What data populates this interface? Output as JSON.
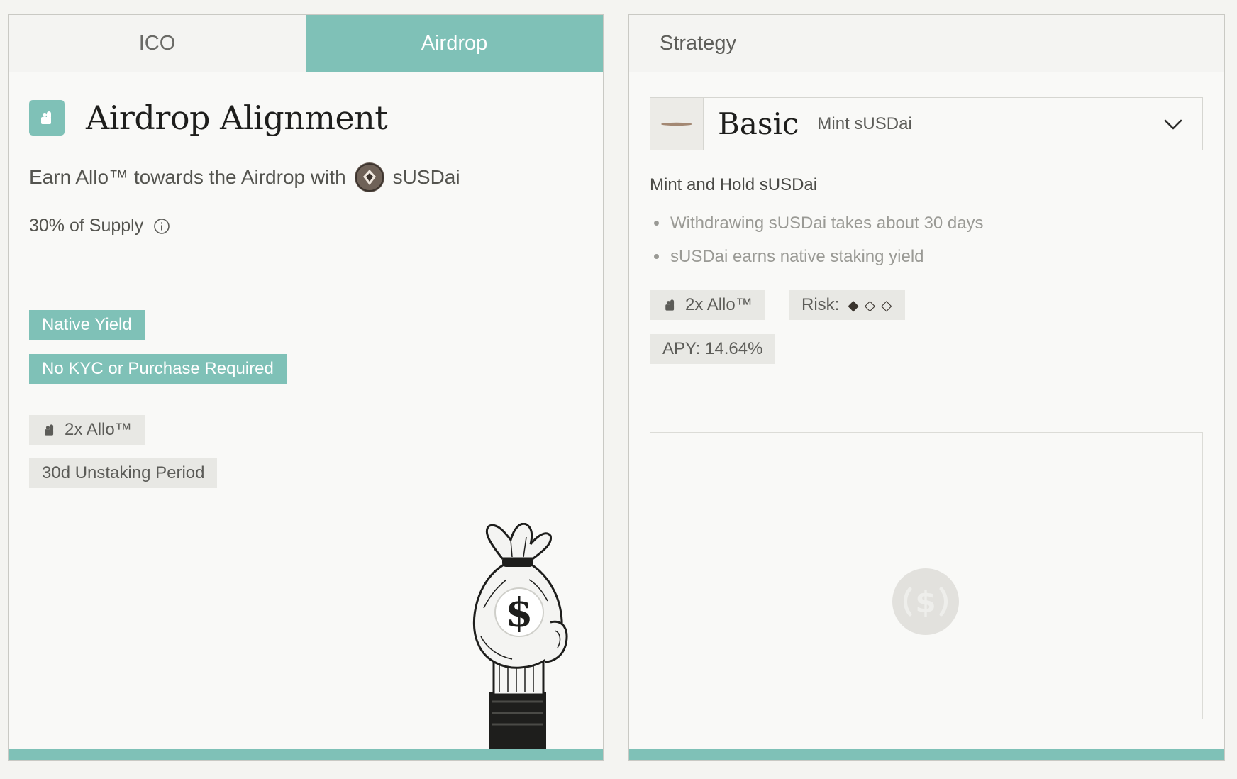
{
  "tabs": [
    {
      "label": "ICO",
      "active": false
    },
    {
      "label": "Airdrop",
      "active": true
    }
  ],
  "airdrop": {
    "title": "Airdrop Alignment",
    "subtitle_prefix": "Earn Allo™ towards the Airdrop with",
    "token": "sUSDai",
    "supply": "30% of Supply",
    "tags_teal": [
      "Native Yield",
      "No KYC or Purchase Required"
    ],
    "multiplier": "2x Allo™",
    "unstaking": "30d Unstaking Period"
  },
  "strategy": {
    "header": "Strategy",
    "selected": {
      "name": "Basic",
      "subtitle": "Mint sUSDai"
    },
    "heading": "Mint and Hold sUSDai",
    "bullets": [
      "Withdrawing sUSDai takes about 30 days",
      "sUSDai earns native staking yield"
    ],
    "multiplier": "2x Allo™",
    "risk_label": "Risk:",
    "risk_level": 1,
    "risk_max": 3,
    "apy": "APY: 14.64%"
  },
  "colors": {
    "accent": "#7fc1b7",
    "chip_bg": "#e8e8e4",
    "panel_bg": "#f9f9f7"
  },
  "icons": {
    "title": "allo-hand-icon",
    "info": "info-icon",
    "token": "susdai-token-icon",
    "chevron": "chevron-down-icon",
    "placeholder": "usd-coin-icon"
  }
}
